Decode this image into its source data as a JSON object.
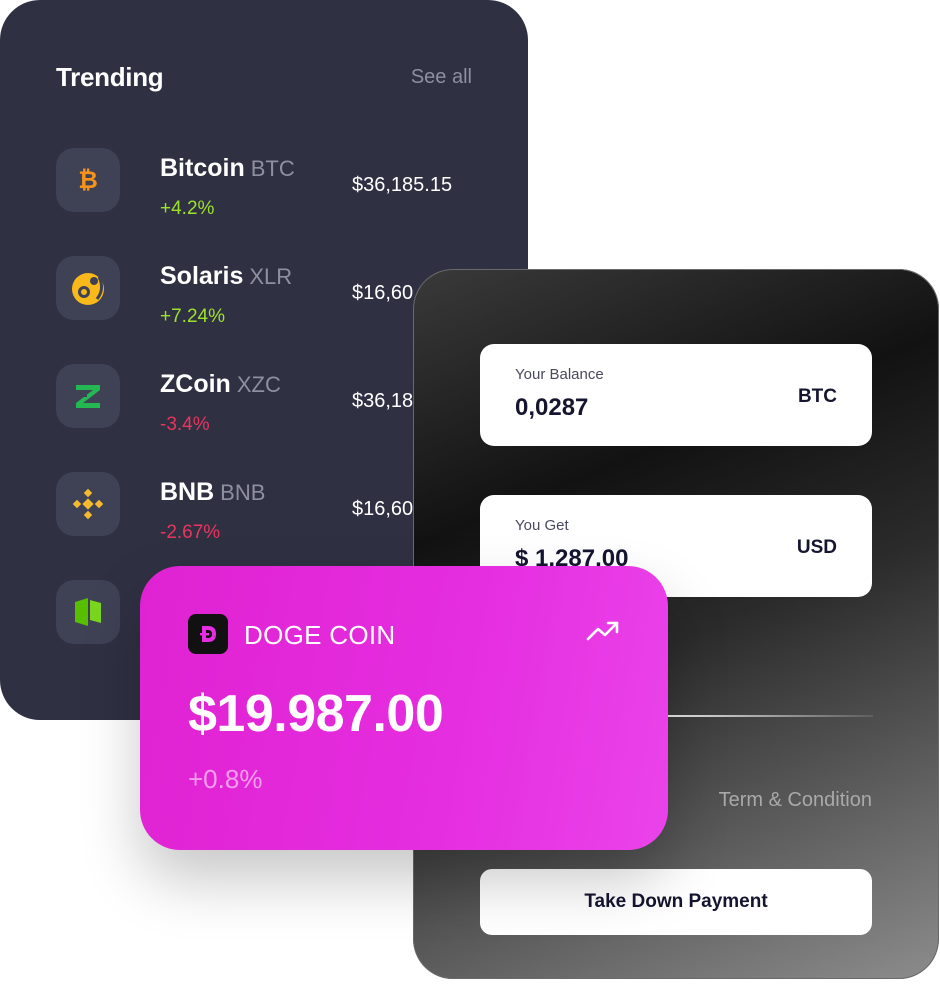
{
  "trending": {
    "title": "Trending",
    "see_all": "See all",
    "coins": [
      {
        "name": "Bitcoin",
        "symbol": "BTC",
        "change": "+4.2%",
        "price": "$36,185.15",
        "icon": "bitcoin-icon",
        "color": "#f7931a"
      },
      {
        "name": "Solaris",
        "symbol": "XLR",
        "change": "+7.24%",
        "price": "$16,60",
        "icon": "solaris-icon",
        "color": "#f9b91b"
      },
      {
        "name": "ZCoin",
        "symbol": "XZC",
        "change": "-3.4%",
        "price": "$36,18",
        "icon": "zcoin-icon",
        "color": "#23b852"
      },
      {
        "name": "BNB",
        "symbol": "BNB",
        "change": "-2.67%",
        "price": "$16,60",
        "icon": "bnb-icon",
        "color": "#f3ba2f"
      },
      {
        "icon": "neo-icon",
        "color": "#58bf00"
      }
    ]
  },
  "exchange": {
    "balance": {
      "label": "Your Balance",
      "value": "0,0287",
      "unit": "BTC"
    },
    "get": {
      "label": "You Get",
      "value": "$ 1,287.00",
      "unit": "USD"
    },
    "terms": "Term & Condition",
    "pay_button": "Take Down Payment"
  },
  "doge": {
    "name": "DOGE COIN",
    "price": "$19.987.00",
    "change": "+0.8%",
    "icon": "dogecoin-icon",
    "trend_icon": "trending-up-icon",
    "accent": "#e52ee0"
  }
}
